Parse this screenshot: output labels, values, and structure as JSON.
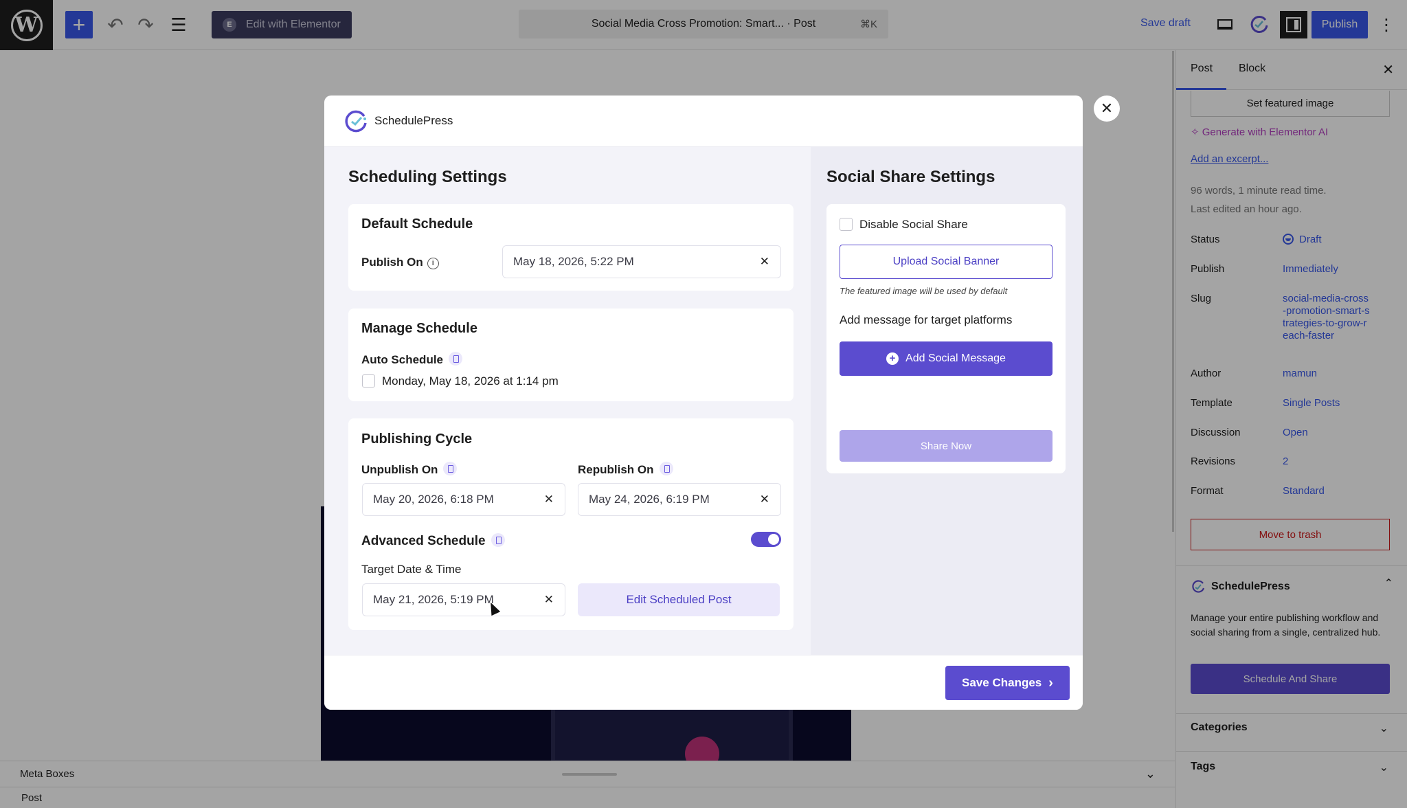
{
  "toolbar": {
    "wp_logo": "W",
    "add_icon": "+",
    "undo_icon": "↶",
    "redo_icon": "↷",
    "doc_overview_icon": "☰",
    "elementor_label": "Edit with Elementor",
    "elementor_icon": "E",
    "document_title": "Social Media Cross Promotion: Smart... · Post",
    "shortcut": "⌘K",
    "save_draft": "Save draft",
    "publish": "Publish",
    "options_icon": "⋮"
  },
  "sidebar": {
    "tabs": [
      "Post",
      "Block"
    ],
    "close_icon": "✕",
    "featured_image": "Set featured image",
    "generate_ai": "✧ Generate with Elementor AI",
    "add_excerpt": "Add an excerpt...",
    "word_count": "96 words, 1 minute read time.",
    "last_edited": "Last edited an hour ago.",
    "meta": [
      {
        "key": "Status",
        "value": "Draft"
      },
      {
        "key": "Publish",
        "value": "Immediately"
      },
      {
        "key": "Slug",
        "value": "social-media-cross-promotion-smart-strategies-to-grow-reach-faster"
      },
      {
        "key": "Author",
        "value": "mamun"
      },
      {
        "key": "Template",
        "value": "Single Posts"
      },
      {
        "key": "Discussion",
        "value": "Open"
      },
      {
        "key": "Revisions",
        "value": "2"
      },
      {
        "key": "Format",
        "value": "Standard"
      }
    ],
    "move_to_trash": "Move to trash",
    "schedulepress_title": "SchedulePress",
    "schedulepress_desc": "Manage your entire publishing workflow and social sharing from a single, centralized hub.",
    "schedule_and_share": "Schedule And Share",
    "categories": "Categories",
    "tags": "Tags",
    "chev_up": "⌃",
    "chev_down": "⌄"
  },
  "editor": {
    "meta_boxes": "Meta Boxes",
    "footer_breadcrumb": "Post",
    "meta_chev": "⌄"
  },
  "modal": {
    "brand": "SchedulePress",
    "close_icon": "✕",
    "scheduling": {
      "title": "Scheduling Settings",
      "default_schedule": {
        "title": "Default Schedule",
        "publish_on_label": "Publish On",
        "publish_on_value": "May 18, 2026, 5:22 PM"
      },
      "manage_schedule": {
        "title": "Manage Schedule",
        "auto_schedule_label": "Auto Schedule",
        "auto_schedule_option": "Monday, May 18, 2026 at 1:14 pm",
        "auto_schedule_checked": false
      },
      "publishing_cycle": {
        "title": "Publishing Cycle",
        "unpublish_label": "Unpublish On",
        "unpublish_value": "May 20, 2026, 6:18 PM",
        "republish_label": "Republish On",
        "republish_value": "May 24, 2026, 6:19 PM",
        "advanced_label": "Advanced Schedule",
        "advanced_enabled": true,
        "target_label": "Target Date & Time",
        "target_value": "May 21, 2026, 5:19 PM",
        "edit_scheduled": "Edit Scheduled Post"
      },
      "clear_icon": "✕"
    },
    "social": {
      "title": "Social Share Settings",
      "disable_label": "Disable Social Share",
      "disable_checked": false,
      "upload_banner": "Upload Social Banner",
      "hint": "The featured image will be used by default",
      "add_message_label": "Add message for target platforms",
      "add_message_button": "Add Social Message",
      "plus_icon": "+",
      "share_now": "Share Now"
    },
    "save_changes": "Save Changes",
    "save_chev": "›"
  },
  "colors": {
    "accent": "#5b4ccf",
    "wp_blue": "#3858e9",
    "danger": "#cc1818"
  }
}
